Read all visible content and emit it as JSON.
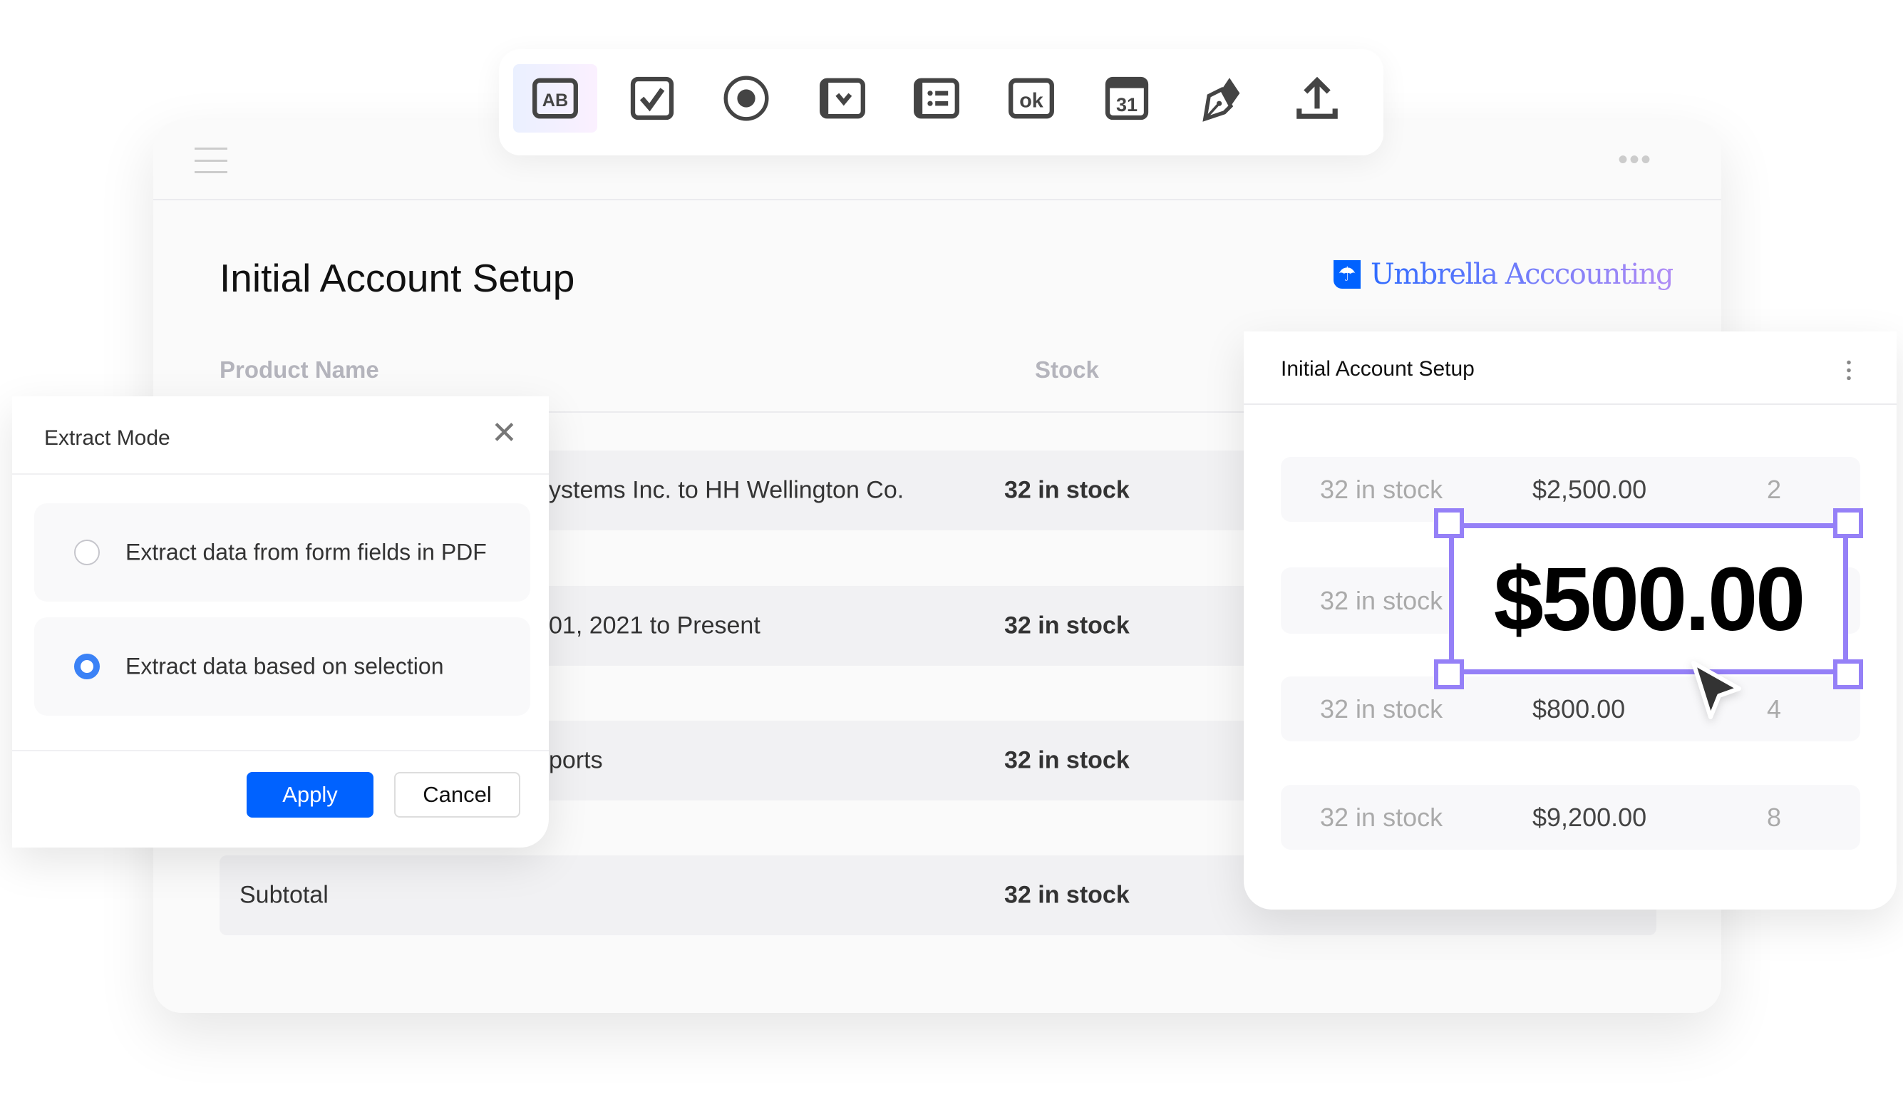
{
  "toolbar": {
    "tools": [
      {
        "icon": "text-field-icon",
        "label": "AB"
      },
      {
        "icon": "checkbox-icon"
      },
      {
        "icon": "radio-button-icon"
      },
      {
        "icon": "dropdown-icon"
      },
      {
        "icon": "list-box-icon"
      },
      {
        "icon": "button-icon",
        "label": "ok"
      },
      {
        "icon": "date-field-icon",
        "label": "31"
      },
      {
        "icon": "signature-icon"
      },
      {
        "icon": "upload-icon"
      }
    ]
  },
  "document": {
    "title": "Initial Account Setup",
    "logo": "Umbrella Acccounting",
    "columns": {
      "product": "Product Name",
      "stock": "Stock"
    },
    "rows": [
      {
        "product": "ystems Inc. to HH Wellington Co.",
        "stock": "32 in stock"
      },
      {
        "product": "01, 2021 to Present",
        "stock": "32 in stock"
      },
      {
        "product": "ports",
        "stock": "32 in stock"
      },
      {
        "product": "Subtotal",
        "stock": "32 in stock"
      }
    ]
  },
  "dialog": {
    "title": "Extract Mode",
    "options": [
      {
        "label": "Extract data from form fields in PDF",
        "selected": false
      },
      {
        "label": "Extract data based on selection",
        "selected": true
      }
    ],
    "apply": "Apply",
    "cancel": "Cancel"
  },
  "side_card": {
    "title": "Initial Account Setup",
    "rows": [
      {
        "stock": "32 in stock",
        "price": "$2,500.00",
        "qty": "2"
      },
      {
        "stock": "32 in stock",
        "price": "",
        "qty": ""
      },
      {
        "stock": "32 in stock",
        "price": "$800.00",
        "qty": "4"
      },
      {
        "stock": "32 in stock",
        "price": "$9,200.00",
        "qty": "8"
      }
    ],
    "selection": "$500.00"
  },
  "colors": {
    "accent": "#0062ff",
    "selection": "#9580f7",
    "radio": "#3b82f6"
  }
}
